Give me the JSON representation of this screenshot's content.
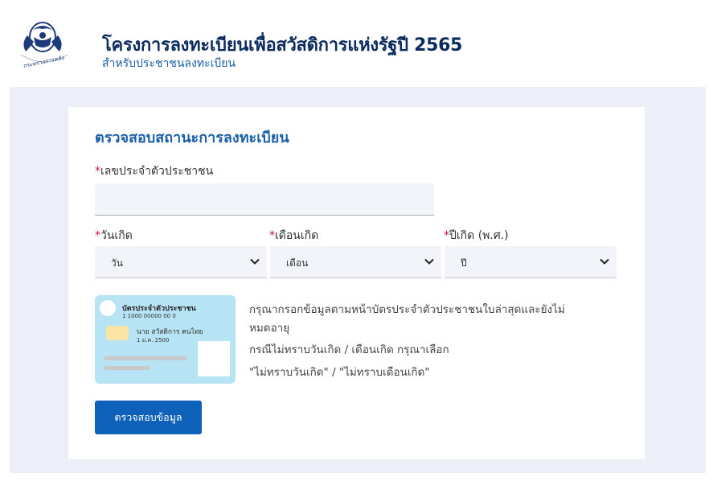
{
  "header": {
    "logo_text": "กระทรวงการคลัง",
    "title": "โครงการลงทะเบียนเพื่อสวัสดิการแห่งรัฐปี 2565",
    "subtitle": "สำหรับประชาชนลงทะเบียน"
  },
  "form": {
    "title": "ตรวจสอบสถานะการลงทะเบียน",
    "required_mark": "*",
    "id_label": "เลขประจำตัวประชาชน",
    "id_value": "",
    "day_label": "วันเกิด",
    "day_value": "วัน",
    "month_label": "เดือนเกิด",
    "month_value": "เดือน",
    "year_label": "ปีเกิด (พ.ศ.)",
    "year_value": "ปี",
    "submit_label": "ตรวจสอบข้อมูล"
  },
  "id_card": {
    "card_title": "บัตรประจำตัวประชาชน",
    "card_number": "1 1000 00000 00 0",
    "holder_name": "นาย สวัสดิการ คนไทย",
    "birth_date": "1 ม.ค. 2500"
  },
  "hint": {
    "line1": "กรุณากรอกข้อมูลตามหน้าบัตรประจำตัวประชาชนใบล่าสุดและยังไม่",
    "line2": "หมดอายุ",
    "line3": "กรณีไม่ทราบวันเกิด / เดือนเกิด กรุณาเลือก",
    "line4": "\"ไม่ทราบวันเกิด\" / \"ไม่ทราบเดือนเกิด\""
  },
  "colors": {
    "title": "#0b2a5e",
    "accent": "#1b5fa8",
    "button": "#0e61b8",
    "required": "#c8102e",
    "page_bg": "#eceef8",
    "card_bg": "#b7e4f5"
  }
}
